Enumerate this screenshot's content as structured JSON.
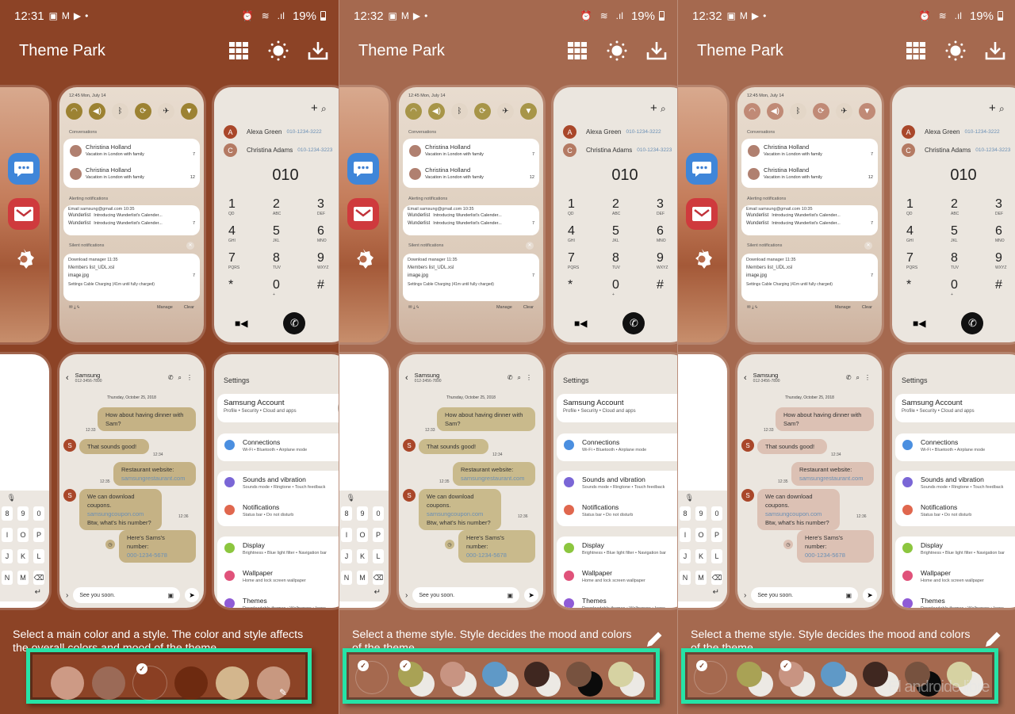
{
  "app": {
    "title": "Theme Park"
  },
  "panels": [
    {
      "status": {
        "time": "12:31",
        "battery": "19%"
      },
      "bg": "#8c4326",
      "accent_fill": "#8c6d2e",
      "qs_color": "#9c8232",
      "bubble_color": "#c5b285",
      "description": "Select a main color and a style. The color and style affects the overall colors and mood of the theme.",
      "show_pencil": false,
      "swatches": [
        {
          "name": "light-pink",
          "color": "#cd9a85",
          "selected": false
        },
        {
          "name": "mauve-brown",
          "color": "#9b6a57",
          "selected": false
        },
        {
          "name": "rust",
          "color": "#8a3f23",
          "selected": true
        },
        {
          "name": "dark-brown",
          "color": "#6d2a10",
          "selected": false
        },
        {
          "name": "beige",
          "color": "#d3b68d",
          "selected": false
        },
        {
          "name": "custom",
          "color": "#c89880",
          "selected": false,
          "edit": true
        }
      ]
    },
    {
      "status": {
        "time": "12:32",
        "battery": "19%"
      },
      "bg": "#a5694f",
      "qs_color": "#a79548",
      "bubble_color": "#c9ba8c",
      "description": "Select a theme style. Style decides the mood and colors of the theme.",
      "show_pencil": true,
      "styles": [
        {
          "name": "default",
          "front": "#a5694f",
          "back": "",
          "selected": true
        },
        {
          "name": "olive",
          "front": "#a9a255",
          "back": "#ece9e4",
          "selected": true
        },
        {
          "name": "rose",
          "front": "#c89482",
          "back": "#ece9e4",
          "selected": false
        },
        {
          "name": "blue",
          "front": "#5f99c7",
          "back": "#ece9e4",
          "selected": false
        },
        {
          "name": "espresso",
          "front": "#3f2720",
          "back": "#ece9e4",
          "selected": false
        },
        {
          "name": "cocoa-dark",
          "front": "#77523f",
          "back": "#0b0b0b",
          "selected": false
        },
        {
          "name": "cream",
          "front": "#d6d2a2",
          "back": "#ece9e4",
          "selected": false
        }
      ]
    },
    {
      "status": {
        "time": "12:32",
        "battery": "19%"
      },
      "bg": "#a5694f",
      "qs_color": "#c08a76",
      "bubble_color": "#dcc1b4",
      "description": "Select a theme style. Style decides the mood and colors of the theme.",
      "show_pencil": true,
      "styles": [
        {
          "name": "default",
          "front": "#a5694f",
          "back": "",
          "selected": true
        },
        {
          "name": "olive",
          "front": "#a9a255",
          "back": "#ece9e4",
          "selected": false
        },
        {
          "name": "rose",
          "front": "#c89482",
          "back": "#ece9e4",
          "selected": true
        },
        {
          "name": "blue",
          "front": "#5f99c7",
          "back": "#ece9e4",
          "selected": false
        },
        {
          "name": "espresso",
          "front": "#3f2720",
          "back": "#ece9e4",
          "selected": false
        },
        {
          "name": "cocoa-dark",
          "front": "#77523f",
          "back": "#0b0b0b",
          "selected": false
        },
        {
          "name": "cream",
          "front": "#d6d2a2",
          "back": "#ece9e4",
          "selected": false
        }
      ]
    }
  ],
  "notification_preview": {
    "datetime": "12:45 Mon, July 14",
    "conversations_label": "Conversations",
    "conversations": [
      {
        "name": "Christina Holland",
        "text": "Vacation in London with family",
        "count": "7"
      },
      {
        "name": "Christina Holland",
        "text": "Vacation in London with family",
        "count": "12"
      }
    ],
    "alerting_label": "Alerting notifications",
    "email_header": "Email  samsung@gmail.com  10:35",
    "alerting": [
      {
        "app": "Wunderlist",
        "text": "Introducing Wunderlist's Calender..."
      },
      {
        "app": "Wunderlist",
        "text": "Introducing Wunderlist's Calender...",
        "count": "7"
      }
    ],
    "silent_label": "Silent notifications",
    "download_header": "Download manager  11:35",
    "files": [
      "Members list_UDL.xsl",
      "image.jpg"
    ],
    "files_count": "7",
    "settings_line": "Settings  Cable Charging (41m until fully charged)",
    "manage": "Manage",
    "clear": "Clear"
  },
  "dialer_preview": {
    "contacts": [
      {
        "initial": "A",
        "name": "Alexa Green",
        "number": "010-1234-3222",
        "color": "#a9472a"
      },
      {
        "initial": "C",
        "name": "Christina Adams",
        "number": "010-1234-3223",
        "color": "#b47a63"
      }
    ],
    "entered": "010",
    "keys": [
      {
        "d": "1",
        "l": "QD"
      },
      {
        "d": "2",
        "l": "ABC"
      },
      {
        "d": "3",
        "l": "DEF"
      },
      {
        "d": "4",
        "l": "GHI"
      },
      {
        "d": "5",
        "l": "JKL"
      },
      {
        "d": "6",
        "l": "MNO"
      },
      {
        "d": "7",
        "l": "PQRS"
      },
      {
        "d": "8",
        "l": "TUV"
      },
      {
        "d": "9",
        "l": "WXYZ"
      },
      {
        "d": "*",
        "l": ""
      },
      {
        "d": "0",
        "l": "+"
      },
      {
        "d": "#",
        "l": ""
      }
    ]
  },
  "messages_preview": {
    "contact": "Samsung",
    "number": "012-3456-7890",
    "date": "Thursday, October 25, 2018",
    "messages": [
      {
        "dir": "out",
        "text": "How about having dinner with Sam?",
        "time": "12:33"
      },
      {
        "dir": "in",
        "text": "That sounds good!",
        "time": "12:34"
      },
      {
        "dir": "out",
        "text": "Restaurant website:",
        "link": "samsungrestaurant.com",
        "time": "12:35"
      },
      {
        "dir": "in",
        "text": "We can download coupons.",
        "link": "samsungcoupon.com",
        "text2": "Btw, what's his number?",
        "time": "12:36"
      },
      {
        "dir": "out",
        "text": "Here's Sams's number:",
        "link": "000-1234-5678"
      }
    ],
    "input": "See you soon."
  },
  "settings_preview": {
    "title": "Settings",
    "account": {
      "title": "Samsung Account",
      "sub": "Profile  •  Security  •  Cloud and apps"
    },
    "items": [
      {
        "t": "Connections",
        "s": "Wi-Fi  •  Bluetooth  •  Airplane mode",
        "c": "#4b8fe0"
      },
      {
        "t": "Sounds and vibration",
        "s": "Sounds mode  •  Ringtone  •  Touch feedback",
        "c": "#7a66d6"
      },
      {
        "t": "Notifications",
        "s": "Status bar  •  Do not disturb",
        "c": "#e0674e"
      },
      {
        "t": "Display",
        "s": "Brightness  •  Blue light filter  •  Navigation bar",
        "c": "#8cc63f"
      },
      {
        "t": "Wallpaper",
        "s": "Home and lock screen wallpaper",
        "c": "#e0527a"
      },
      {
        "t": "Themes",
        "s": "Downloadable themes  •  Wallpapers  •  Icons",
        "c": "#8f5bd6"
      }
    ]
  },
  "keyboard_preview": {
    "rows": [
      [
        "8",
        "9",
        "0"
      ],
      [
        "I",
        "O",
        "P"
      ],
      [
        "J",
        "K",
        "L"
      ],
      [
        "N",
        "M",
        "⌫"
      ]
    ]
  },
  "watermark": "El androide libre"
}
